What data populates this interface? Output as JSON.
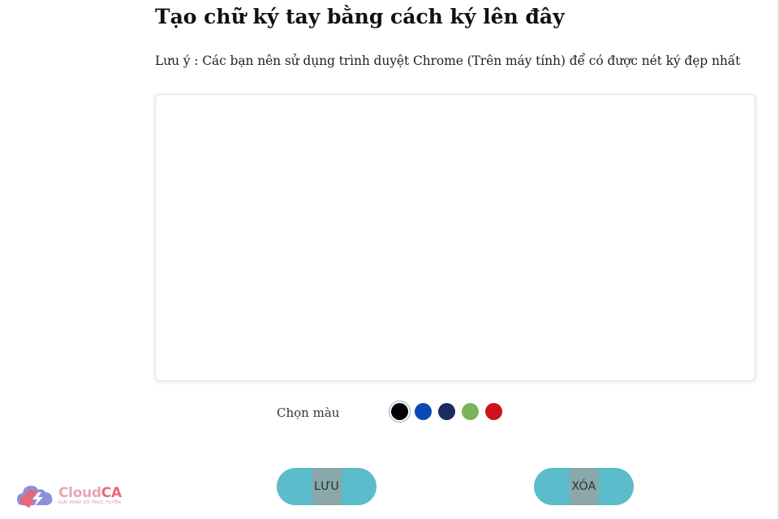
{
  "page": {
    "title": "Tạo chữ ký tay bằng cách ký lên đây",
    "note": "Lưu ý : Các bạn nên sử dụng trình duyệt Chrome (Trên máy tính) để có được nét ký đẹp nhất"
  },
  "color_picker": {
    "label": "Chọn màu",
    "selected": "#000000",
    "swatches": [
      "#000000",
      "#0a49b5",
      "#1a2b5e",
      "#79b35b",
      "#d0121b"
    ]
  },
  "buttons": {
    "save_label": "LƯU",
    "clear_label": "XÓA"
  },
  "logo": {
    "name_part1": "Cloud",
    "name_part2": "CA",
    "tagline": "GIẢI PHÁP SỐ TRỰC TUYẾN",
    "icon": "cloud-lightning-icon",
    "colors": {
      "primary": "#e5687f",
      "secondary": "#8c8fd8"
    }
  }
}
